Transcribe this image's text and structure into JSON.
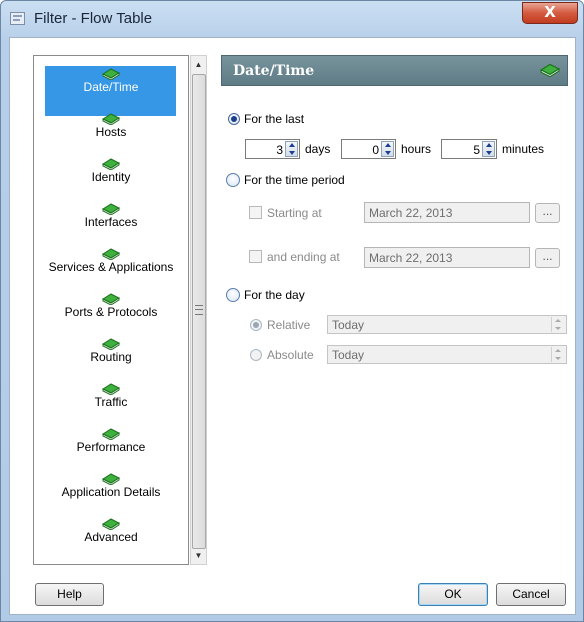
{
  "window": {
    "title": "Filter - Flow Table",
    "close_label": "X"
  },
  "nav": {
    "items": [
      {
        "label": "Date/Time",
        "selected": true
      },
      {
        "label": "Hosts"
      },
      {
        "label": "Identity"
      },
      {
        "label": "Interfaces"
      },
      {
        "label": "Services & Applications"
      },
      {
        "label": "Ports & Protocols"
      },
      {
        "label": "Routing"
      },
      {
        "label": "Traffic"
      },
      {
        "label": "Performance"
      },
      {
        "label": "Application Details"
      },
      {
        "label": "Advanced"
      }
    ],
    "icon": "green-book-icon"
  },
  "panel": {
    "title": "Date/Time",
    "for_the_last": {
      "label": "For the last",
      "selected": true,
      "days_value": "3",
      "days_label": "days",
      "hours_value": "0",
      "hours_label": "hours",
      "minutes_value": "5",
      "minutes_label": "minutes"
    },
    "time_period": {
      "label": "For the time period",
      "starting_label": "Starting at",
      "starting_value": "March 22, 2013",
      "ending_label": "and ending at",
      "ending_value": "March 22, 2013",
      "browse_label": "..."
    },
    "for_the_day": {
      "label": "For the day",
      "relative_label": "Relative",
      "relative_value": "Today",
      "absolute_label": "Absolute",
      "absolute_value": "Today"
    }
  },
  "buttons": {
    "help": "Help",
    "ok": "OK",
    "cancel": "Cancel"
  },
  "colors": {
    "selection": "#3597e6",
    "header": "#6b8891",
    "icon": "#2e9a2e"
  }
}
